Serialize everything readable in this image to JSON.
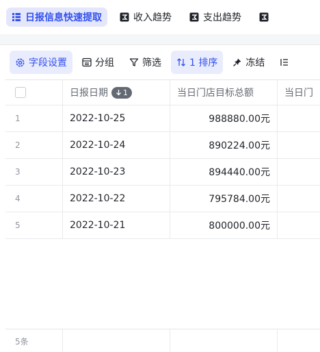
{
  "view_tabs": [
    {
      "label": "日报信息快速提取",
      "icon": "grid-view-icon",
      "active": true
    },
    {
      "label": "收入趋势",
      "icon": "chart-view-icon",
      "active": false
    },
    {
      "label": "支出趋势",
      "icon": "chart-view-icon",
      "active": false
    },
    {
      "label": "",
      "icon": "chart-view-icon",
      "active": false
    }
  ],
  "toolbar": {
    "field_settings": "字段设置",
    "group": "分组",
    "filter": "筛选",
    "sort": "1 排序",
    "freeze": "冻结"
  },
  "table": {
    "columns": [
      {
        "label": "日报日期",
        "sort_badge": "1"
      },
      {
        "label": "当日门店目标总额"
      },
      {
        "label": "当日门"
      }
    ],
    "rows": [
      {
        "num": "1",
        "date": "2022-10-25",
        "target": "988880.00元"
      },
      {
        "num": "2",
        "date": "2022-10-24",
        "target": "890224.00元"
      },
      {
        "num": "3",
        "date": "2022-10-23",
        "target": "894440.00元"
      },
      {
        "num": "4",
        "date": "2022-10-22",
        "target": "795784.00元"
      },
      {
        "num": "5",
        "date": "2022-10-21",
        "target": "800000.00元"
      }
    ],
    "footer_count": "5条"
  },
  "colors": {
    "accent": "#3250ee",
    "active_tab_bg": "#e4e7fb",
    "border": "#e9eaeb",
    "muted_text": "#646a73"
  }
}
